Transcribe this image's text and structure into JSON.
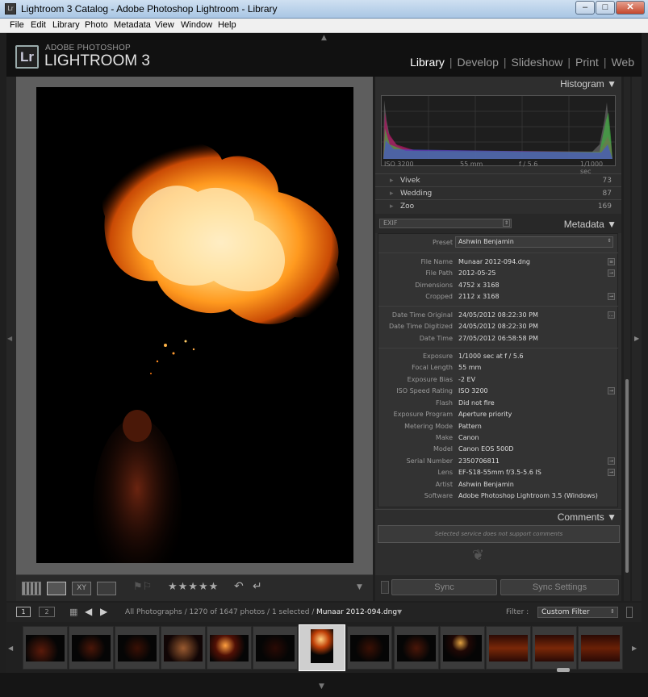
{
  "window": {
    "title": "Lightroom 3 Catalog - Adobe Photoshop Lightroom - Library",
    "app_icon": "Lr",
    "min": "–",
    "max": "□",
    "close": "✕"
  },
  "menu": [
    "File",
    "Edit",
    "Library",
    "Photo",
    "Metadata",
    "View",
    "Window",
    "Help"
  ],
  "header": {
    "logo": "Lr",
    "brand_top": "ADOBE PHOTOSHOP",
    "brand_main": "LIGHTROOM 3",
    "modules": [
      "Library",
      "Develop",
      "Slideshow",
      "Print",
      "Web"
    ],
    "active_module": "Library"
  },
  "histogram": {
    "title": "Histogram",
    "iso": "ISO 3200",
    "focal": "55 mm",
    "aperture": "f / 5.6",
    "shutter": "1/1000 sec"
  },
  "keywords": [
    {
      "name": "Vivek",
      "count": "73"
    },
    {
      "name": "Wedding",
      "count": "87"
    },
    {
      "name": "Zoo",
      "count": "169"
    }
  ],
  "metadata": {
    "title": "Metadata",
    "set": "EXIF",
    "preset_label": "Preset",
    "preset_value": "Ashwin Benjamin",
    "fields": [
      {
        "k": "File Name",
        "v": "Munaar 2012-094.dng"
      },
      {
        "k": "File Path",
        "v": "2012-05-25"
      },
      {
        "k": "Dimensions",
        "v": "4752 x 3168"
      },
      {
        "k": "Cropped",
        "v": "2112 x 3168"
      },
      {
        "k": "Date Time Original",
        "v": "24/05/2012 08:22:30 PM"
      },
      {
        "k": "Date Time Digitized",
        "v": "24/05/2012 08:22:30 PM"
      },
      {
        "k": "Date Time",
        "v": "27/05/2012 06:58:58 PM"
      },
      {
        "k": "Exposure",
        "v": "1/1000 sec at f / 5.6"
      },
      {
        "k": "Focal Length",
        "v": "55 mm"
      },
      {
        "k": "Exposure Bias",
        "v": "-2 EV"
      },
      {
        "k": "ISO Speed Rating",
        "v": "ISO 3200"
      },
      {
        "k": "Flash",
        "v": "Did not fire"
      },
      {
        "k": "Exposure Program",
        "v": "Aperture priority"
      },
      {
        "k": "Metering Mode",
        "v": "Pattern"
      },
      {
        "k": "Make",
        "v": "Canon"
      },
      {
        "k": "Model",
        "v": "Canon EOS 500D"
      },
      {
        "k": "Serial Number",
        "v": "2350706811"
      },
      {
        "k": "Lens",
        "v": "EF-S18-55mm f/3.5-5.6 IS"
      },
      {
        "k": "Artist",
        "v": "Ashwin Benjamin"
      },
      {
        "k": "Software",
        "v": "Adobe Photoshop Lightroom 3.5 (Windows)"
      }
    ]
  },
  "comments": {
    "title": "Comments",
    "note": "Selected service does not support comments"
  },
  "sync": {
    "sync": "Sync",
    "sync_settings": "Sync Settings"
  },
  "toolbar": {
    "stars": "★★★★★"
  },
  "filmbar": {
    "page1": "1",
    "page2": "2",
    "path": "All Photographs / 1270 of 1647 photos / 1 selected /",
    "filename": "Munaar 2012-094.dng",
    "filter_label": "Filter :",
    "filter_value": "Custom Filter"
  }
}
